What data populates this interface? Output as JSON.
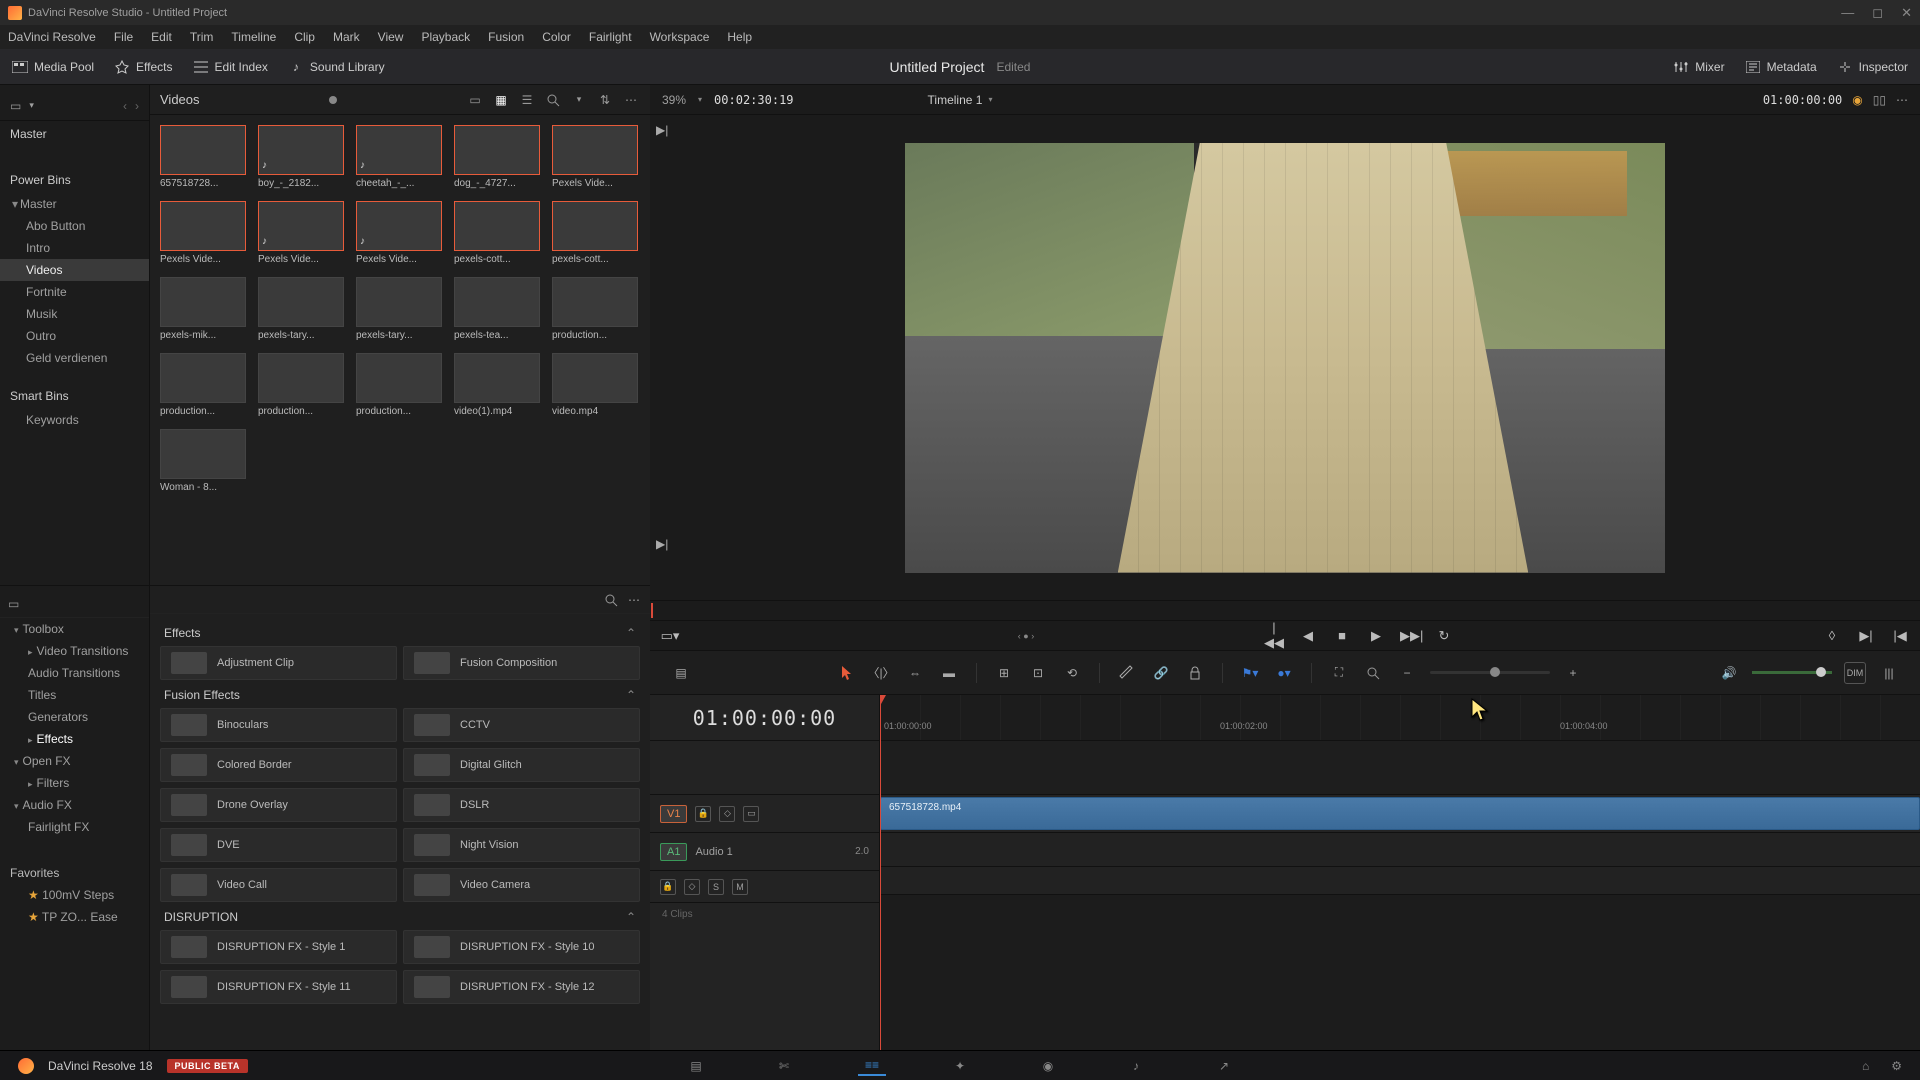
{
  "titlebar": {
    "text": "DaVinci Resolve Studio - Untitled Project"
  },
  "menu": [
    "DaVinci Resolve",
    "File",
    "Edit",
    "Trim",
    "Timeline",
    "Clip",
    "Mark",
    "View",
    "Playback",
    "Fusion",
    "Color",
    "Fairlight",
    "Workspace",
    "Help"
  ],
  "toolbar": {
    "mediaPool": "Media Pool",
    "effects": "Effects",
    "editIndex": "Edit Index",
    "soundLibrary": "Sound Library",
    "projectName": "Untitled Project",
    "projectStatus": "Edited",
    "mixer": "Mixer",
    "metadata": "Metadata",
    "inspector": "Inspector"
  },
  "pool": {
    "breadcrumb": "Videos",
    "binsHeader": "Master",
    "powerBins": "Power Bins",
    "powerMaster": "Master",
    "children": [
      "Abo Button",
      "Intro",
      "Videos",
      "Fortnite",
      "Musik",
      "Outro",
      "Geld verdienen"
    ],
    "smartBins": "Smart Bins",
    "smartChild": "Keywords"
  },
  "clips": [
    {
      "label": "657518728...",
      "cls": "th-sky",
      "sel": true
    },
    {
      "label": "boy_-_2182...",
      "cls": "th-red",
      "sel": true,
      "mus": true
    },
    {
      "label": "cheetah_-_...",
      "cls": "th-grass",
      "sel": true,
      "mus": true
    },
    {
      "label": "dog_-_4727...",
      "cls": "th-field",
      "sel": true
    },
    {
      "label": "Pexels Vide...",
      "cls": "th-dark",
      "sel": true
    },
    {
      "label": "Pexels Vide...",
      "cls": "th-pink",
      "sel": true
    },
    {
      "label": "Pexels Vide...",
      "cls": "th-wall",
      "sel": true,
      "mus": true
    },
    {
      "label": "Pexels Vide...",
      "cls": "th-brown",
      "sel": true,
      "mus": true
    },
    {
      "label": "pexels-cott...",
      "cls": "th-dark",
      "sel": true
    },
    {
      "label": "pexels-cott...",
      "cls": "th-dark",
      "sel": true
    },
    {
      "label": "pexels-mik...",
      "cls": "th-brown"
    },
    {
      "label": "pexels-tary...",
      "cls": "th-field"
    },
    {
      "label": "pexels-tary...",
      "cls": "th-brown"
    },
    {
      "label": "pexels-tea...",
      "cls": "th-dark"
    },
    {
      "label": "production...",
      "cls": "th-green"
    },
    {
      "label": "production...",
      "cls": "th-white"
    },
    {
      "label": "production...",
      "cls": "th-road"
    },
    {
      "label": "production...",
      "cls": "th-brown"
    },
    {
      "label": "video(1).mp4",
      "cls": "th-face"
    },
    {
      "label": "video.mp4",
      "cls": "th-park"
    },
    {
      "label": "Woman - 8...",
      "cls": "th-wall"
    }
  ],
  "fxTree": {
    "toolbox": "Toolbox",
    "toolboxItems": [
      "Video Transitions",
      "Audio Transitions",
      "Titles",
      "Generators",
      "Effects"
    ],
    "openFx": "Open FX",
    "filters": "Filters",
    "audioFx": "Audio FX",
    "fairlight": "Fairlight FX",
    "favorites": "Favorites",
    "fav1": "100mV Steps",
    "fav2": "TP ZO... Ease"
  },
  "fxList": {
    "effectsHdr": "Effects",
    "adjClip": "Adjustment Clip",
    "fusionComp": "Fusion Composition",
    "fusionHdr": "Fusion Effects",
    "fusion": [
      [
        "Binoculars",
        "CCTV"
      ],
      [
        "Colored Border",
        "Digital Glitch"
      ],
      [
        "Drone Overlay",
        "DSLR"
      ],
      [
        "DVE",
        "Night Vision"
      ],
      [
        "Video Call",
        "Video Camera"
      ]
    ],
    "disruptHdr": "DISRUPTION",
    "disrupt": [
      [
        "DISRUPTION FX - Style 1",
        "DISRUPTION FX - Style 10"
      ],
      [
        "DISRUPTION FX - Style 11",
        "DISRUPTION FX - Style 12"
      ]
    ]
  },
  "viewer": {
    "zoom": "39%",
    "dur": "00:02:30:19",
    "timeline": "Timeline 1",
    "tc": "01:00:00:00"
  },
  "timeline": {
    "tc": "01:00:00:00",
    "ruler": [
      "01:00:00:00",
      "01:00:02:00",
      "01:00:04:00"
    ],
    "v1": "V1",
    "a1": "A1",
    "audio1": "Audio 1",
    "gain": "2.0",
    "clipName": "657518728.mp4",
    "clipsTxt": "4 Clips",
    "sBox": "S",
    "mBox": "M"
  },
  "bottom": {
    "version": "DaVinci Resolve 18",
    "beta": "PUBLIC BETA"
  },
  "colors": {
    "accent": "#e75b3a",
    "clipBlue": "#4a7aa8"
  }
}
